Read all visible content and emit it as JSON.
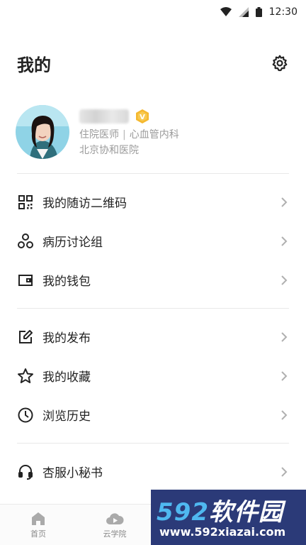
{
  "status_bar": {
    "time": "12:30"
  },
  "header": {
    "title": "我的"
  },
  "profile": {
    "title": "住院医师",
    "department": "心血管内科",
    "hospital": "北京协和医院",
    "badge_letter": "V",
    "badge_color": "#f5b82e"
  },
  "menu": {
    "qr": "我的随访二维码",
    "case_group": "病历讨论组",
    "wallet": "我的钱包",
    "posts": "我的发布",
    "favorites": "我的收藏",
    "history": "浏览历史",
    "support": "杏服小秘书"
  },
  "tabs": [
    {
      "label": "首页",
      "icon": "home-icon"
    },
    {
      "label": "云学院",
      "icon": "cloud-play-icon"
    }
  ],
  "watermark": {
    "brand_number": "592",
    "brand_text": "软件园",
    "url": "www.592xiazai.com"
  },
  "colors": {
    "accent": "#f5b82e",
    "text": "#222222",
    "muted": "#9a9a9a"
  }
}
